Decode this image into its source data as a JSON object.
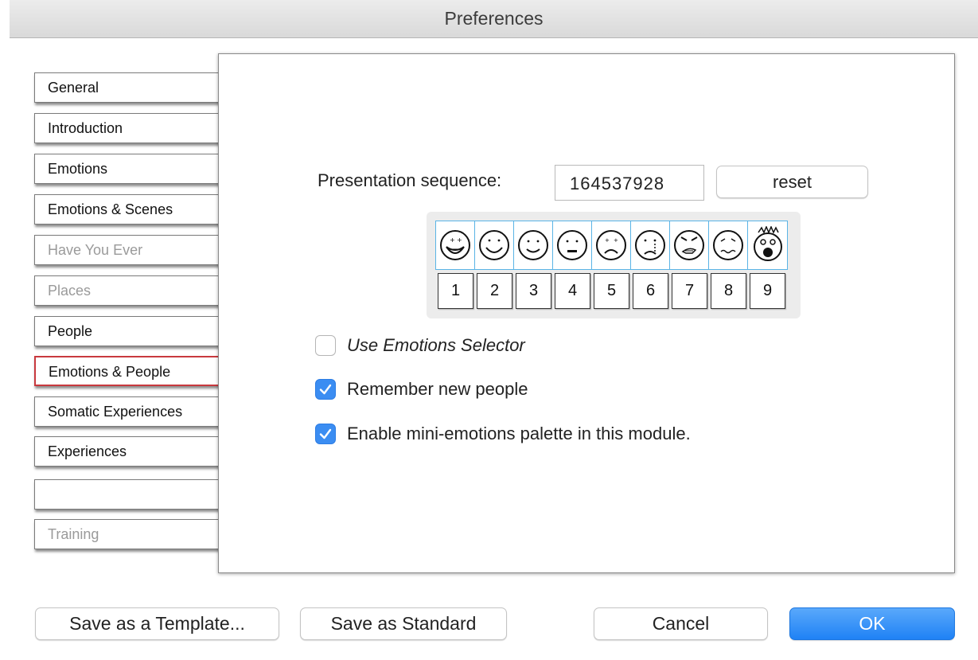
{
  "window": {
    "title": "Preferences"
  },
  "sidebar": {
    "items": [
      {
        "label": "General",
        "state": "normal"
      },
      {
        "label": "Introduction",
        "state": "normal"
      },
      {
        "label": "Emotions",
        "state": "normal"
      },
      {
        "label": "Emotions & Scenes",
        "state": "normal"
      },
      {
        "label": "Have You Ever",
        "state": "disabled"
      },
      {
        "label": "Places",
        "state": "disabled"
      },
      {
        "label": "People",
        "state": "normal"
      },
      {
        "label": "Emotions & People",
        "state": "selected"
      },
      {
        "label": "Somatic Experiences",
        "state": "normal"
      },
      {
        "label": "Experiences",
        "state": "normal"
      },
      {
        "label": "",
        "state": "normal"
      },
      {
        "label": "Training",
        "state": "disabled"
      }
    ]
  },
  "panel": {
    "sequence_label": "Presentation sequence:",
    "sequence_value": "164537928",
    "reset_label": "reset",
    "emotion_faces": [
      "very-happy-face-icon",
      "happy-face-icon",
      "smile-face-icon",
      "neutral-face-icon",
      "sad-face-icon",
      "crying-face-icon",
      "angry-face-icon",
      "worried-face-icon",
      "shocked-face-icon"
    ],
    "emotion_numbers": [
      "1",
      "2",
      "3",
      "4",
      "5",
      "6",
      "7",
      "8",
      "9"
    ],
    "options": [
      {
        "label": "Use Emotions Selector",
        "checked": false,
        "italic": true
      },
      {
        "label": "Remember new people",
        "checked": true,
        "italic": false
      },
      {
        "label": "Enable mini-emotions palette in this module.",
        "checked": true,
        "italic": false
      }
    ]
  },
  "footer": {
    "save_template": "Save as a Template...",
    "save_standard": "Save as Standard",
    "cancel": "Cancel",
    "ok": "OK"
  },
  "colors": {
    "accent": "#1f82f5",
    "selected_border": "#c8393e",
    "grid_blue": "#5ab4e6"
  }
}
